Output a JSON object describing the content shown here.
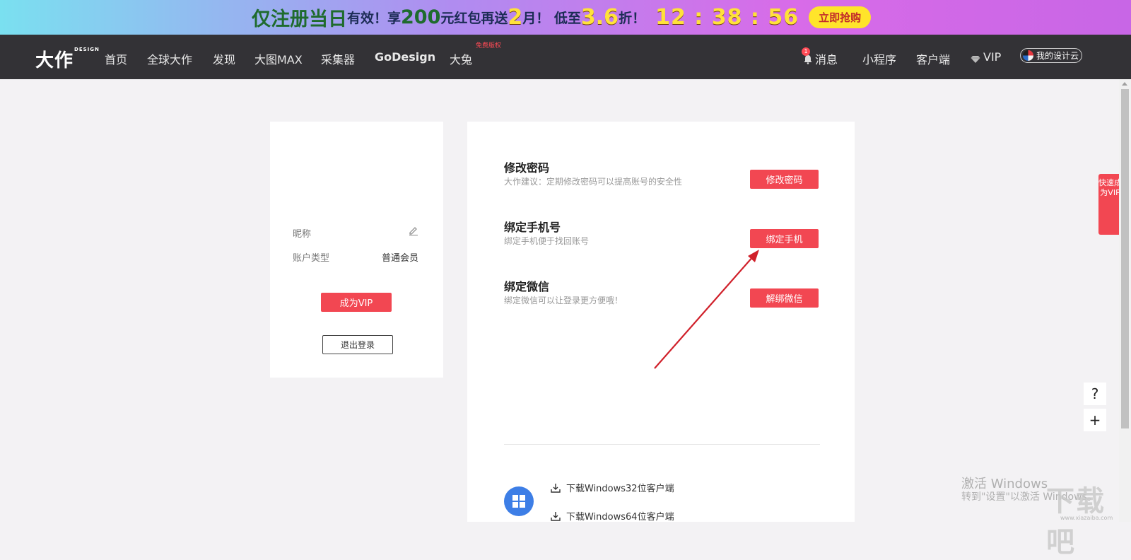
{
  "banner": {
    "text_a": "仅注册当日",
    "text_b": "有效！享",
    "text_c": "200",
    "text_d": "元红包再送",
    "text_e": "2",
    "text_f": "月！ 低至",
    "text_g": "3.6",
    "text_h": "折！",
    "timer": "12 : 38 : 56",
    "buy_button": "立即抢购"
  },
  "nav": {
    "logo": "大作",
    "logo_sup": "DESIGN",
    "items": [
      "首页",
      "全球大作",
      "发现",
      "大图MAX",
      "采集器",
      "GoDesign",
      "大兔"
    ],
    "free_tag": "免费版权",
    "message_count": "1",
    "right_items": [
      "消息",
      "小程序",
      "客户端",
      "VIP"
    ],
    "cloud_button": "我的设计云"
  },
  "left_card": {
    "nickname_label": "昵称",
    "account_type_label": "账户类型",
    "account_type_value": "普通会员",
    "become_vip": "成为VIP",
    "logout": "退出登录"
  },
  "right_card": {
    "sections": [
      {
        "title": "修改密码",
        "desc": "大作建议：定期修改密码可以提高账号的安全性",
        "button": "修改密码"
      },
      {
        "title": "绑定手机号",
        "desc": "绑定手机便于找回账号",
        "button": "绑定手机"
      },
      {
        "title": "绑定微信",
        "desc": "绑定微信可以让登录更方便哦！",
        "button": "解绑微信"
      }
    ],
    "downloads": [
      "下载Windows32位客户端",
      "下载Windows64位客户端"
    ]
  },
  "side": {
    "vip_side": "快速成为VIP",
    "help": "?",
    "plus": "+"
  },
  "watermark": {
    "line1": "激活 Windows",
    "line2": "转到\"设置\"以激活 Windows。",
    "logo": "下载吧",
    "url": "www.xiazaiba.com"
  },
  "colors": {
    "accent": "#f24752",
    "navbar_bg": "#333236",
    "page_bg": "#f3f2f4"
  }
}
